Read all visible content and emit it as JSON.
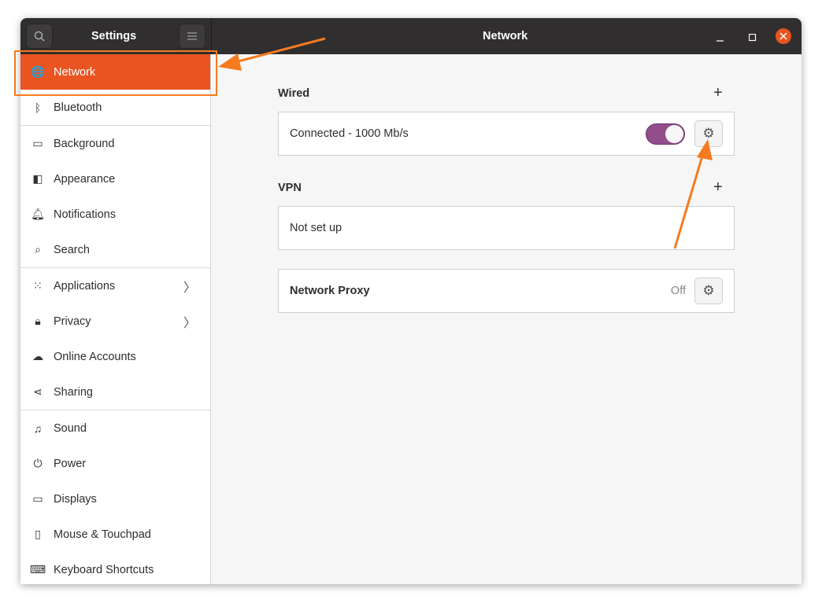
{
  "header": {
    "sidebar_title": "Settings",
    "title": "Network"
  },
  "sidebar": {
    "items": [
      {
        "label": "Network",
        "icon": "globe-icon"
      },
      {
        "label": "Bluetooth",
        "icon": "bluetooth-icon"
      },
      {
        "label": "Background",
        "icon": "monitor-icon"
      },
      {
        "label": "Appearance",
        "icon": "appearance-icon"
      },
      {
        "label": "Notifications",
        "icon": "bell-icon"
      },
      {
        "label": "Search",
        "icon": "search-icon"
      },
      {
        "label": "Applications",
        "icon": "grid-icon"
      },
      {
        "label": "Privacy",
        "icon": "lock-icon"
      },
      {
        "label": "Online Accounts",
        "icon": "cloud-icon"
      },
      {
        "label": "Sharing",
        "icon": "share-icon"
      },
      {
        "label": "Sound",
        "icon": "music-icon"
      },
      {
        "label": "Power",
        "icon": "power-icon"
      },
      {
        "label": "Displays",
        "icon": "display-icon"
      },
      {
        "label": "Mouse & Touchpad",
        "icon": "mouse-icon"
      },
      {
        "label": "Keyboard Shortcuts",
        "icon": "keyboard-icon"
      }
    ]
  },
  "main": {
    "wired": {
      "title": "Wired",
      "status": "Connected - 1000 Mb/s",
      "enabled": true
    },
    "vpn": {
      "title": "VPN",
      "status": "Not set up"
    },
    "proxy": {
      "title": "Network Proxy",
      "status": "Off"
    }
  },
  "colors": {
    "accent": "#e95420",
    "toggle": "#924d8b",
    "annotation": "#f47b20"
  }
}
